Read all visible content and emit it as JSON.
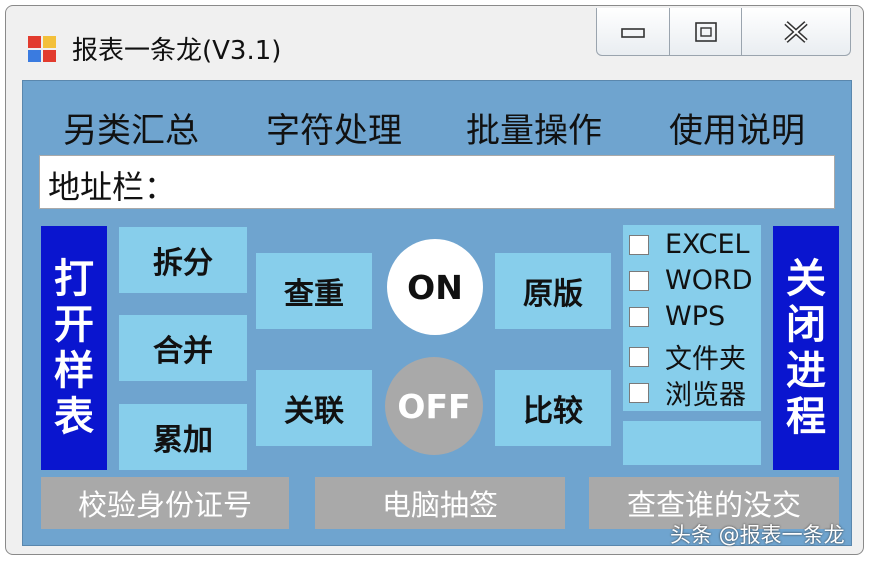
{
  "window": {
    "title": "报表一条龙(V3.1)",
    "controls": {
      "minimize": "minimize-icon",
      "maximize": "maximize-icon",
      "close": "close-icon"
    }
  },
  "menu": [
    "另类汇总",
    "字符处理",
    "批量操作",
    "使用说明"
  ],
  "address_bar": {
    "label": "地址栏：",
    "value": ""
  },
  "buttons": {
    "open_sample": "打开样表",
    "split": "拆分",
    "merge": "合并",
    "accumulate": "累加",
    "dedupe": "查重",
    "associate": "关联",
    "on": "ON",
    "off": "OFF",
    "original": "原版",
    "compare": "比较",
    "close_process": "关闭进程",
    "verify_id": "校验身份证号",
    "computer_draw": "电脑抽签",
    "check_missing": "查查谁的没交"
  },
  "checkboxes": [
    {
      "label": "EXCEL",
      "checked": false
    },
    {
      "label": "WORD",
      "checked": false
    },
    {
      "label": "WPS",
      "checked": false
    },
    {
      "label": "文件夹",
      "checked": false
    },
    {
      "label": "浏览器",
      "checked": false
    }
  ],
  "watermark": "头条 @报表一条龙",
  "colors": {
    "client_bg": "#6fa4cf",
    "tile": "#87ceeb",
    "side_button": "#0a15cf",
    "on_circle": "#ffffff",
    "off_circle": "#a9a9a9",
    "bottom_button": "#a9a9a9"
  }
}
